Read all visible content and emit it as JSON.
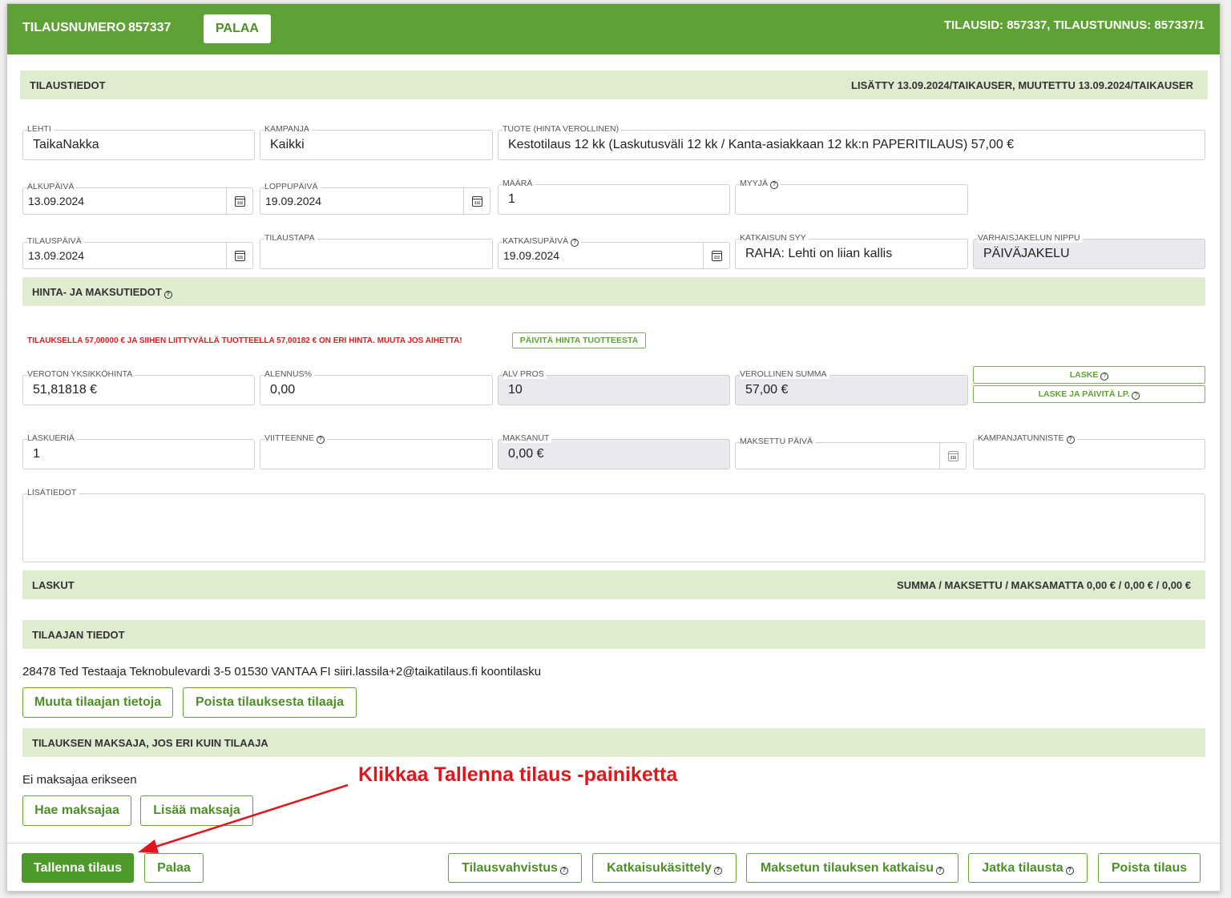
{
  "header": {
    "order_label": "TILAUSNUMERO",
    "order_number": "857337",
    "back_button": "PALAA",
    "ids": "TILAUSID: 857337, TILAUSTUNNUS: 857337/1"
  },
  "order_info": {
    "title": "TILAUSTIEDOT",
    "meta": "LISÄTTY 13.09.2024/TAIKAUSER, MUUTETTU 13.09.2024/TAIKAUSER",
    "lehti": {
      "label": "LEHTI",
      "value": "TaikaNakka"
    },
    "kampanja": {
      "label": "KAMPANJA",
      "value": "Kaikki"
    },
    "tuote": {
      "label": "TUOTE (HINTA VEROLLINEN)",
      "value": "Kestotilaus 12 kk (Laskutusväli 12 kk / Kanta-asiakkaan 12 kk:n PAPERITILAUS) 57,00 €"
    },
    "alkupaiva": {
      "label": "ALKUPÄIVÄ",
      "value": "13.09.2024"
    },
    "loppupaiva": {
      "label": "LOPPUPÄIVÄ",
      "value": "19.09.2024"
    },
    "maara": {
      "label": "MÄÄRÄ",
      "value": "1"
    },
    "myyja": {
      "label": "MYYJÄ",
      "value": ""
    },
    "tilauspaiva": {
      "label": "TILAUSPÄIVÄ",
      "value": "13.09.2024"
    },
    "tilaustapa": {
      "label": "TILAUSTAPA",
      "value": ""
    },
    "katkaisupaiva": {
      "label": "KATKAISUPÄIVÄ",
      "value": "19.09.2024"
    },
    "katkaisun_syy": {
      "label": "KATKAISUN SYY",
      "value": "RAHA: Lehti on liian kallis"
    },
    "nippu": {
      "label": "VARHAISJAKELUN NIPPU",
      "value": "PÄIVÄJAKELU"
    }
  },
  "price": {
    "title": "HINTA- JA MAKSUTIEDOT",
    "warning": "TILAUKSELLA 57,00000 € JA SIIHEN LIITTYVÄLLÄ TUOTTEELLA 57,00182 € ON ERI HINTA. MUUTA JOS AIHETTA!",
    "update_button": "PÄIVITÄ HINTA TUOTTEESTA",
    "veroton": {
      "label": "VEROTON YKSIKKÖHINTA",
      "value": "51,81818 €"
    },
    "alennus": {
      "label": "ALENNUS%",
      "value": "0,00"
    },
    "alv": {
      "label": "ALV PROS",
      "value": "10"
    },
    "verollinen": {
      "label": "VEROLLINEN SUMMA",
      "value": "57,00 €"
    },
    "laske_button": "LASKE",
    "laske_update_button": "LASKE JA PÄIVITÄ LP.",
    "laskueria": {
      "label": "LASKUERIÄ",
      "value": "1"
    },
    "viitteenne": {
      "label": "VIITTEENNE",
      "value": ""
    },
    "maksanut": {
      "label": "MAKSANUT",
      "value": "0,00 €"
    },
    "maksettu_paiva": {
      "label": "MAKSETTU PÄIVÄ",
      "value": ""
    },
    "kampanjatunniste": {
      "label": "KAMPANJATUNNISTE",
      "value": ""
    },
    "lisatiedot": {
      "label": "LISÄTIEDOT",
      "value": ""
    }
  },
  "invoices": {
    "title": "LASKUT",
    "summary": "SUMMA / MAKSETTU / MAKSAMATTA 0,00 € / 0,00 € / 0,00 €"
  },
  "customer": {
    "title": "TILAAJAN TIEDOT",
    "info": "28478 Ted Testaaja Teknobulevardi 3-5 01530 VANTAA FI siiri.lassila+2@taikatilaus.fi koontilasku",
    "edit_button": "Muuta tilaajan tietoja",
    "remove_button": "Poista tilauksesta tilaaja"
  },
  "payer": {
    "title": "TILAUKSEN MAKSAJA, JOS ERI KUIN TILAAJA",
    "info": "Ei maksajaa erikseen",
    "search_button": "Hae maksajaa",
    "add_button": "Lisää maksaja"
  },
  "annotation": "Klikkaa Tallenna tilaus -painiketta",
  "footer": {
    "save": "Tallenna tilaus",
    "back": "Palaa",
    "confirm": "Tilausvahvistus",
    "cancel_handling": "Katkaisukäsittely",
    "paid_cancel": "Maksetun tilauksen katkaisu",
    "continue": "Jatka tilausta",
    "delete": "Poista tilaus"
  },
  "colors": {
    "brand_green": "#5ea235",
    "section_bg": "#dfecd0",
    "warning_red": "#e01b1b",
    "annotation_red": "#e0161c"
  }
}
